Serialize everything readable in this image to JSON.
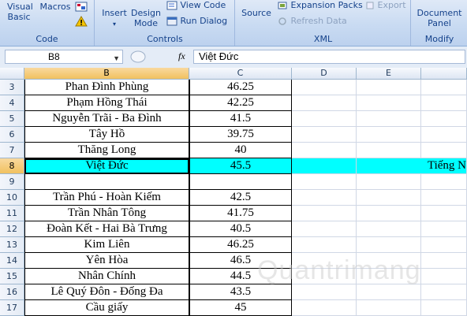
{
  "ribbon": {
    "code_group": {
      "label": "Code",
      "visual_basic": "Visual Basic",
      "macros": "Macros"
    },
    "controls_group": {
      "label": "Controls",
      "insert": "Insert",
      "design_mode": "Design Mode",
      "view_code": "View Code",
      "run_dialog": "Run Dialog"
    },
    "xml_group": {
      "label": "XML",
      "source": "Source",
      "expansion_packs": "Expansion Packs",
      "export": "Export",
      "refresh_data": "Refresh Data"
    },
    "modify_group": {
      "label": "Modify",
      "document_panel": "Document Panel"
    }
  },
  "formula_bar": {
    "name_box": "B8",
    "fx": "fx",
    "value": "Việt Đức"
  },
  "columns": [
    "B",
    "C",
    "D",
    "E"
  ],
  "rows": [
    {
      "num": "3",
      "b": "Phan Đình Phùng",
      "c": "46.25",
      "f": ""
    },
    {
      "num": "4",
      "b": "Phạm Hồng Thái",
      "c": "42.25",
      "f": ""
    },
    {
      "num": "5",
      "b": "Nguyễn Trãi - Ba Đình",
      "c": "41.5",
      "f": ""
    },
    {
      "num": "6",
      "b": "Tây Hồ",
      "c": "39.75",
      "f": ""
    },
    {
      "num": "7",
      "b": "Thăng Long",
      "c": "40",
      "f": ""
    },
    {
      "num": "8",
      "b": "Việt Đức",
      "c": "45.5",
      "f": "Tiếng N"
    },
    {
      "num": "9",
      "b": "",
      "c": "",
      "f": ""
    },
    {
      "num": "10",
      "b": "Trần Phú - Hoàn Kiếm",
      "c": "42.5",
      "f": ""
    },
    {
      "num": "11",
      "b": "Trần Nhân Tông",
      "c": "41.75",
      "f": ""
    },
    {
      "num": "12",
      "b": "Đoàn Kết - Hai Bà Trưng",
      "c": "40.5",
      "f": ""
    },
    {
      "num": "13",
      "b": "Kim Liên",
      "c": "46.25",
      "f": ""
    },
    {
      "num": "14",
      "b": "Yên Hòa",
      "c": "46.5",
      "f": ""
    },
    {
      "num": "15",
      "b": "Nhân Chính",
      "c": "44.5",
      "f": ""
    },
    {
      "num": "16",
      "b": "Lê Quý Đôn - Đống Đa",
      "c": "43.5",
      "f": ""
    },
    {
      "num": "17",
      "b": "Cầu giấy",
      "c": "45",
      "f": ""
    }
  ],
  "selected": {
    "row": "8",
    "col": "B"
  },
  "colors": {
    "highlight": "#00ffff",
    "ribbon_text": "#15428b"
  },
  "watermark": "Quantrimang"
}
